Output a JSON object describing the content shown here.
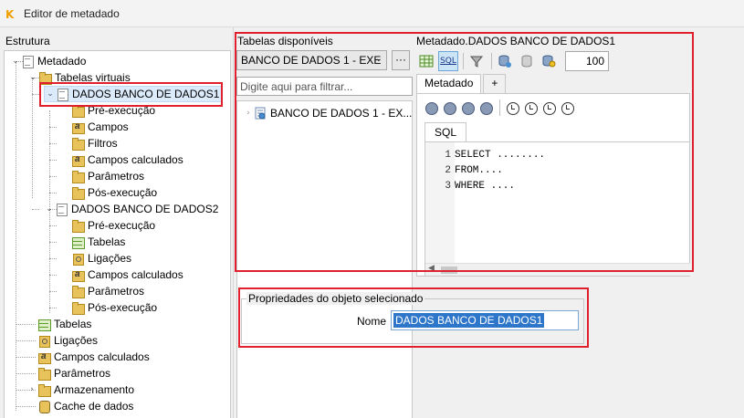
{
  "window": {
    "title": "Editor de metadado",
    "app_icon_glyph": "K"
  },
  "left": {
    "label": "Estrutura",
    "tree": [
      {
        "label": "Metadado",
        "icon": "document-icon"
      },
      {
        "label": "Tabelas virtuais",
        "icon": "folder-icon"
      },
      {
        "label": "DADOS BANCO DE DADOS1",
        "icon": "document-icon",
        "selected": true
      },
      {
        "label": "Pré-execução",
        "icon": "folder-icon"
      },
      {
        "label": "Campos",
        "icon": "field-folder-icon"
      },
      {
        "label": "Filtros",
        "icon": "folder-icon"
      },
      {
        "label": "Campos calculados",
        "icon": "field-folder-icon"
      },
      {
        "label": "Parâmetros",
        "icon": "folder-icon"
      },
      {
        "label": "Pós-execução",
        "icon": "folder-icon"
      },
      {
        "label": "DADOS BANCO DE DADOS2",
        "icon": "document-icon"
      },
      {
        "label": "Pré-execução",
        "icon": "folder-icon"
      },
      {
        "label": "Tabelas",
        "icon": "table-icon"
      },
      {
        "label": "Ligações",
        "icon": "link-icon"
      },
      {
        "label": "Campos calculados",
        "icon": "field-folder-icon"
      },
      {
        "label": "Parâmetros",
        "icon": "folder-icon"
      },
      {
        "label": "Pós-execução",
        "icon": "folder-icon"
      },
      {
        "label": "Tabelas",
        "icon": "table-icon"
      },
      {
        "label": "Ligações",
        "icon": "link-icon"
      },
      {
        "label": "Campos calculados",
        "icon": "field-folder-icon"
      },
      {
        "label": "Parâmetros",
        "icon": "folder-icon"
      },
      {
        "label": "Armazenamento",
        "icon": "folder-icon"
      },
      {
        "label": "Cache de dados",
        "icon": "database-icon"
      }
    ]
  },
  "tables": {
    "label": "Tabelas disponíveis",
    "combo_value": "BANCO DE DADOS 1 - EXE",
    "ellipsis_label": "···",
    "filter_placeholder": "Digite aqui para filtrar...",
    "items": [
      {
        "label": "BANCO DE DADOS 1 - EX..."
      }
    ]
  },
  "metadata": {
    "label": "Metadado.DADOS BANCO DE DADOS1",
    "sql_button_label": "SQL",
    "row_limit": "100",
    "tabs": [
      {
        "label": "Metadado"
      },
      {
        "label": "+"
      }
    ],
    "sql_tab_label": "SQL",
    "code": [
      {
        "n": "1",
        "text": "SELECT ........"
      },
      {
        "n": "2",
        "text": "FROM...."
      },
      {
        "n": "3",
        "text": "WHERE ...."
      }
    ]
  },
  "properties": {
    "legend": "Propriedades do objeto selecionado",
    "name_label": "Nome",
    "name_value": "DADOS BANCO DE DADOS1"
  },
  "colors": {
    "highlight_box": "#e0202c",
    "selection": "#2e76c9"
  }
}
